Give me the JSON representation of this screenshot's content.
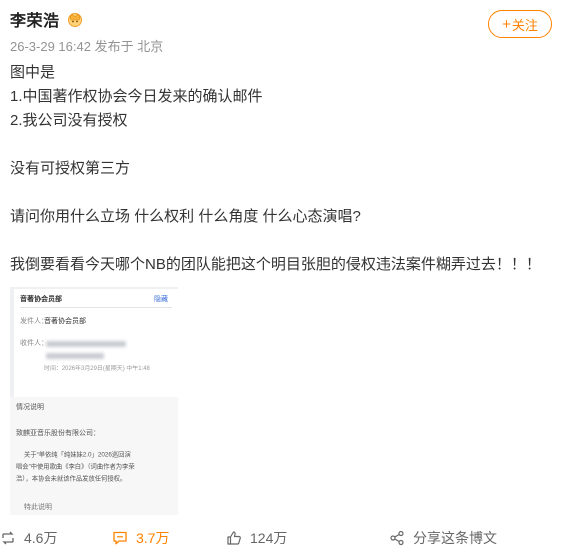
{
  "author": {
    "name": "李荣浩",
    "badge_icon": "vip-crown-icon"
  },
  "meta": {
    "time": "26-3-29 16:42",
    "source": "发布于 北京"
  },
  "follow": {
    "plus": "+",
    "label": "关注"
  },
  "post": {
    "lines": [
      "图中是",
      "1.中国著作权协会今日发来的确认邮件",
      "2.我公司没有授权",
      "",
      "没有可授权第三方",
      "",
      "请问你用什么立场 什么权利 什么角度 什么心态演唱?",
      "",
      "我倒要看看今天哪个NB的团队能把这个明目张胆的侵权违法案件糊弄过去！！！"
    ]
  },
  "document": {
    "header": "音著协会员部",
    "action": "隐藏",
    "sender_label": "发件人：",
    "sender_value": "音著协会员部",
    "recipient_label": "收件人：",
    "date": "时间：2026年3月29日(星期天) 中午1:48",
    "section_title": "情况说明",
    "salutation": "致麒亚音乐股份有限公司：",
    "body_lines": [
      "关于“单依纯「纯妹妹2.0」2026巡回演",
      "唱会”中使用歌曲《李白》（词曲作者为李荣",
      "浩），本协会未就该作品发放任何授权。"
    ],
    "footer": "特此说明"
  },
  "actions": {
    "repost": "4.6万",
    "comment": "3.7万",
    "like": "124万",
    "share": "分享这条博文"
  },
  "colors": {
    "accent": "#ff8200",
    "meta": "#939393",
    "text": "#333333"
  }
}
